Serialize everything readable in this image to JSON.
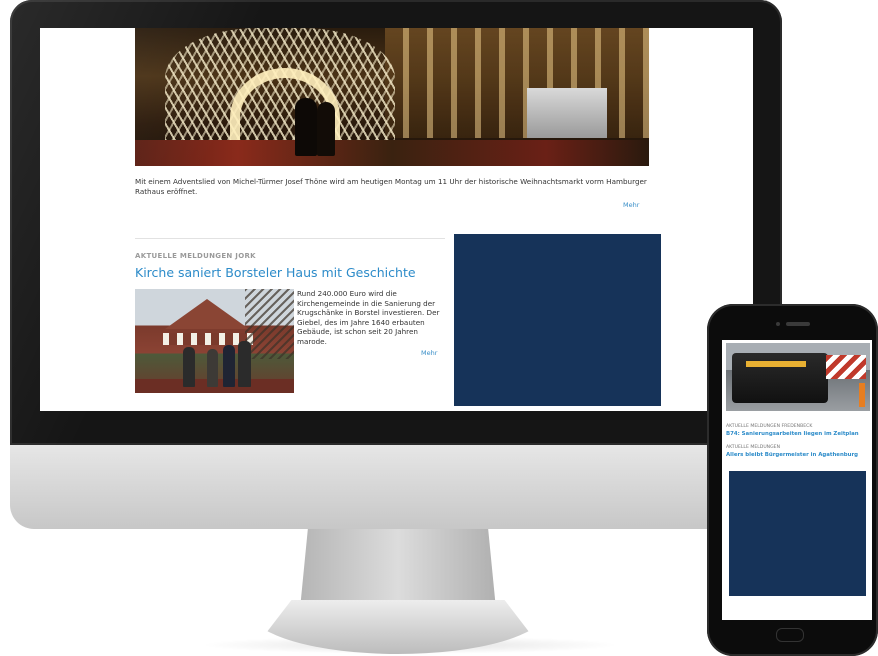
{
  "desktop": {
    "caption": "Mit einem Adventslied von Michel-Türmer Josef Thöne wird am heutigen Montag um 11 Uhr der historische Weihnachtsmarkt vorm Hamburger Rathaus eröffnet.",
    "more_label": "Mehr",
    "article": {
      "kicker": "AKTUELLE MELDUNGEN JORK",
      "headline": "Kirche saniert Borsteler Haus mit Geschichte",
      "teaser": "Rund 240.000 Euro wird die Kirchengemeinde in die Sanierung der Krugschänke in Borstel investieren. Der Giebel, des im Jahre 1640 erbauten Gebäude, ist schon seit 20 Jahren marode.",
      "more_label": "Mehr"
    },
    "ad_color": "#163359"
  },
  "phone": {
    "items": [
      {
        "kicker": "AKTUELLE MELDUNGEN FREDENBECK",
        "title": "B74: Sanierungsarbeiten liegen im Zeitplan"
      },
      {
        "kicker": "AKTUELLE MELDUNGEN",
        "title": "Allers bleibt Bürgermeister in Agathenburg"
      }
    ],
    "ad_color": "#163359"
  },
  "colors": {
    "link": "#2c8bc9",
    "ad": "#163359"
  }
}
